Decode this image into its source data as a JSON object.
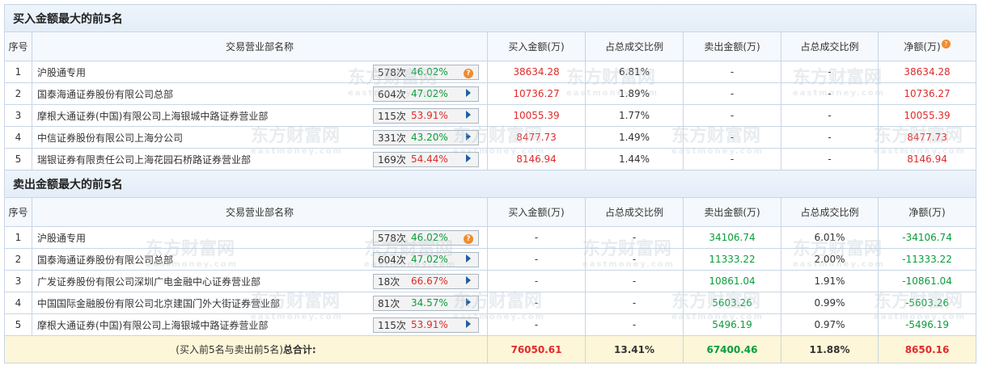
{
  "buy_section": {
    "title": "买入金额最大的前5名",
    "headers": [
      "序号",
      "交易营业部名称",
      "买入金额(万)",
      "占总成交比例",
      "卖出金额(万)",
      "占总成交比例",
      "净额(万)"
    ],
    "rows": [
      {
        "idx": "1",
        "name": "沪股通专用",
        "count": "578次",
        "rate": "46.02%",
        "rate_color": "green",
        "icon": "question-icon",
        "buy": "38634.28",
        "buy_ratio": "6.81%",
        "sell": "-",
        "sell_ratio": "-",
        "net": "38634.28"
      },
      {
        "idx": "2",
        "name": "国泰海通证券股份有限公司总部",
        "count": "604次",
        "rate": "47.02%",
        "rate_color": "green",
        "icon": "arrow-right-icon",
        "buy": "10736.27",
        "buy_ratio": "1.89%",
        "sell": "-",
        "sell_ratio": "-",
        "net": "10736.27"
      },
      {
        "idx": "3",
        "name": "摩根大通证券(中国)有限公司上海银城中路证券营业部",
        "count": "115次",
        "rate": "53.91%",
        "rate_color": "red",
        "icon": "arrow-right-icon",
        "buy": "10055.39",
        "buy_ratio": "1.77%",
        "sell": "-",
        "sell_ratio": "-",
        "net": "10055.39"
      },
      {
        "idx": "4",
        "name": "中信证券股份有限公司上海分公司",
        "count": "331次",
        "rate": "43.20%",
        "rate_color": "green",
        "icon": "arrow-right-icon",
        "buy": "8477.73",
        "buy_ratio": "1.49%",
        "sell": "-",
        "sell_ratio": "-",
        "net": "8477.73"
      },
      {
        "idx": "5",
        "name": "瑞银证券有限责任公司上海花园石桥路证券营业部",
        "count": "169次",
        "rate": "54.44%",
        "rate_color": "red",
        "icon": "arrow-right-icon",
        "buy": "8146.94",
        "buy_ratio": "1.44%",
        "sell": "-",
        "sell_ratio": "-",
        "net": "8146.94"
      }
    ]
  },
  "sell_section": {
    "title": "卖出金额最大的前5名",
    "headers": [
      "序号",
      "交易营业部名称",
      "买入金额(万)",
      "占总成交比例",
      "卖出金额(万)",
      "占总成交比例",
      "净额(万)"
    ],
    "rows": [
      {
        "idx": "1",
        "name": "沪股通专用",
        "count": "578次",
        "rate": "46.02%",
        "rate_color": "green",
        "icon": "question-icon",
        "buy": "-",
        "buy_ratio": "-",
        "sell": "34106.74",
        "sell_ratio": "6.01%",
        "net": "-34106.74"
      },
      {
        "idx": "2",
        "name": "国泰海通证券股份有限公司总部",
        "count": "604次",
        "rate": "47.02%",
        "rate_color": "green",
        "icon": "arrow-right-icon",
        "buy": "-",
        "buy_ratio": "-",
        "sell": "11333.22",
        "sell_ratio": "2.00%",
        "net": "-11333.22"
      },
      {
        "idx": "3",
        "name": "广发证券股份有限公司深圳广电金融中心证券营业部",
        "count": "18次",
        "rate": "66.67%",
        "rate_color": "red",
        "icon": "arrow-right-icon",
        "buy": "-",
        "buy_ratio": "-",
        "sell": "10861.04",
        "sell_ratio": "1.91%",
        "net": "-10861.04"
      },
      {
        "idx": "4",
        "name": "中国国际金融股份有限公司北京建国门外大街证券营业部",
        "count": "81次",
        "rate": "34.57%",
        "rate_color": "green",
        "icon": "arrow-right-icon",
        "buy": "-",
        "buy_ratio": "-",
        "sell": "5603.26",
        "sell_ratio": "0.99%",
        "net": "-5603.26"
      },
      {
        "idx": "5",
        "name": "摩根大通证券(中国)有限公司上海银城中路证券营业部",
        "count": "115次",
        "rate": "53.91%",
        "rate_color": "red",
        "icon": "arrow-right-icon",
        "buy": "-",
        "buy_ratio": "-",
        "sell": "5496.19",
        "sell_ratio": "0.97%",
        "net": "-5496.19"
      }
    ]
  },
  "total": {
    "label_prefix": "(买入前5名与卖出前5名)",
    "label_bold": "总合计:",
    "buy": "76050.61",
    "buy_ratio": "13.41%",
    "sell": "67400.46",
    "sell_ratio": "11.88%",
    "net": "8650.16"
  },
  "watermark": {
    "cn": "东方财富网",
    "en": "eastmoney.com"
  },
  "colors": {
    "up": "#e02a2a",
    "down": "#0a9d3c",
    "header_bg": "#e3edf8",
    "total_bg": "#fdf6d8"
  }
}
